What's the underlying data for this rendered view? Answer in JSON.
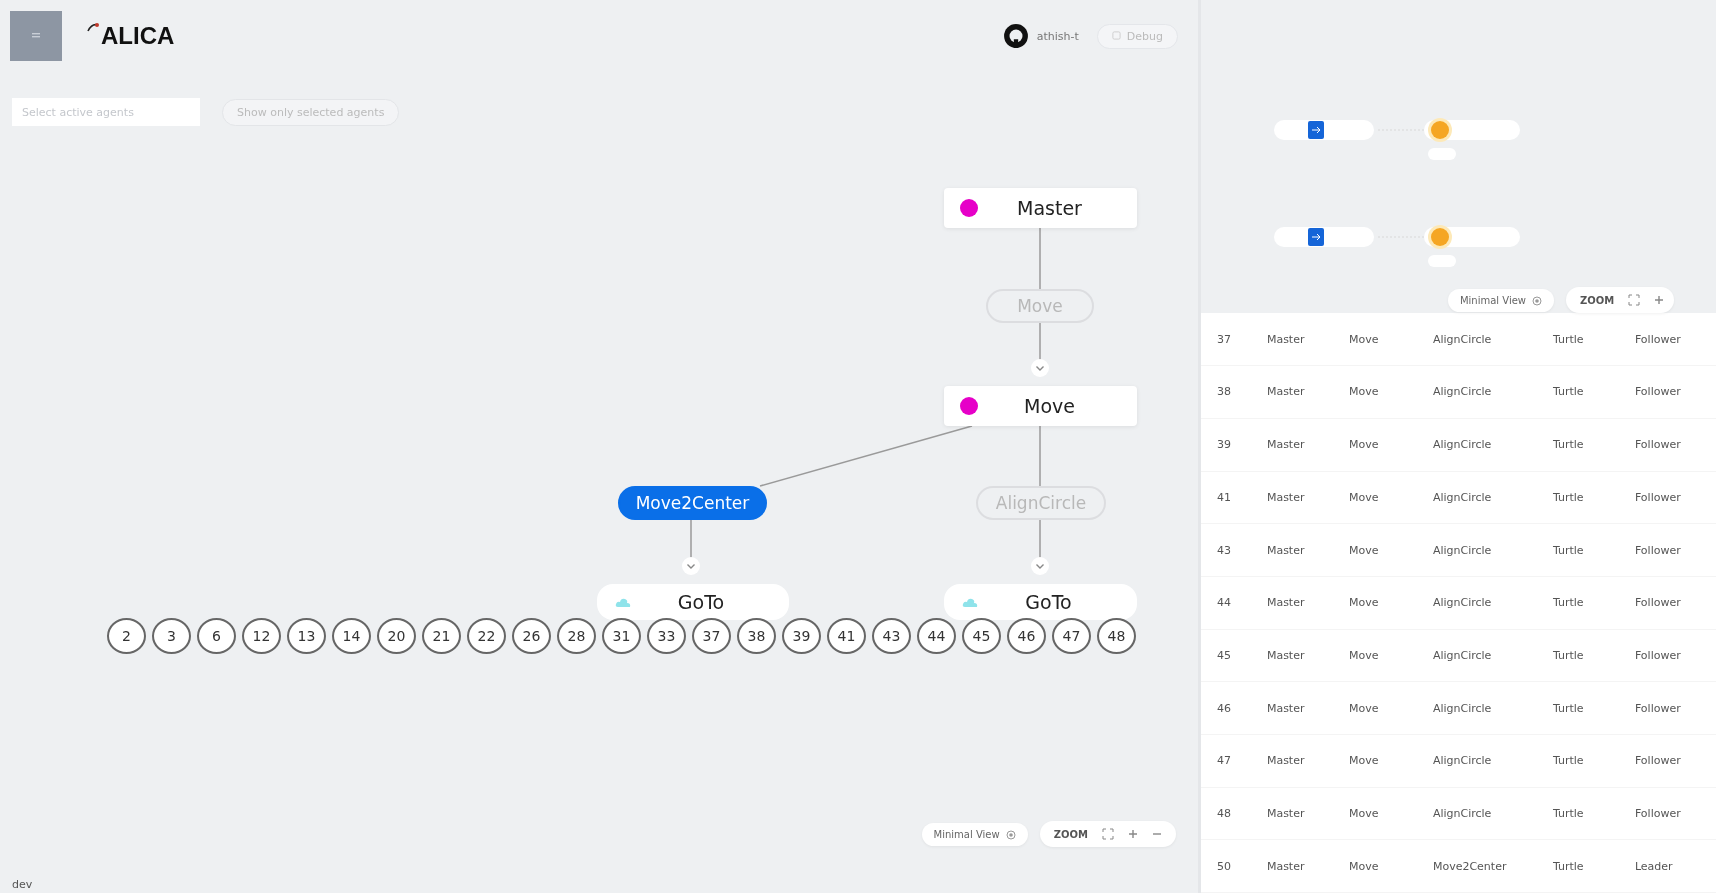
{
  "header": {
    "logo": "ALICA",
    "user": "athish-t",
    "debug_button": "Debug"
  },
  "filters": {
    "agent_select": {
      "placeholder": "Select active agents"
    },
    "show_selected_button": "Show only selected agents"
  },
  "plan_graph": {
    "nodes": [
      {
        "kind": "plan",
        "label": "Master"
      },
      {
        "kind": "state",
        "label": "Move",
        "selected": false
      },
      {
        "kind": "plan",
        "label": "Move"
      },
      {
        "kind": "state",
        "label": "Move2Center",
        "selected": true
      },
      {
        "kind": "state",
        "label": "AlignCircle",
        "selected": false
      },
      {
        "kind": "behaviour",
        "label": "GoTo"
      },
      {
        "kind": "behaviour",
        "label": "GoTo"
      }
    ],
    "agents": [
      "2",
      "3",
      "6",
      "12",
      "13",
      "14",
      "20",
      "21",
      "22",
      "26",
      "28",
      "31",
      "33",
      "37",
      "38",
      "39",
      "41",
      "43",
      "44",
      "45",
      "46",
      "47",
      "48"
    ],
    "view_controls": {
      "minimal_view": "Minimal View",
      "zoom": "ZOOM"
    }
  },
  "environment": "dev",
  "detail_panel": {
    "view_controls": {
      "minimal_view": "Minimal View",
      "zoom": "ZOOM"
    },
    "table": {
      "rows": [
        [
          "37",
          "Master",
          "Move",
          "AlignCircle",
          "Turtle",
          "Follower"
        ],
        [
          "38",
          "Master",
          "Move",
          "AlignCircle",
          "Turtle",
          "Follower"
        ],
        [
          "39",
          "Master",
          "Move",
          "AlignCircle",
          "Turtle",
          "Follower"
        ],
        [
          "41",
          "Master",
          "Move",
          "AlignCircle",
          "Turtle",
          "Follower"
        ],
        [
          "43",
          "Master",
          "Move",
          "AlignCircle",
          "Turtle",
          "Follower"
        ],
        [
          "44",
          "Master",
          "Move",
          "AlignCircle",
          "Turtle",
          "Follower"
        ],
        [
          "45",
          "Master",
          "Move",
          "AlignCircle",
          "Turtle",
          "Follower"
        ],
        [
          "46",
          "Master",
          "Move",
          "AlignCircle",
          "Turtle",
          "Follower"
        ],
        [
          "47",
          "Master",
          "Move",
          "AlignCircle",
          "Turtle",
          "Follower"
        ],
        [
          "48",
          "Master",
          "Move",
          "AlignCircle",
          "Turtle",
          "Follower"
        ],
        [
          "50",
          "Master",
          "Move",
          "Move2Center",
          "Turtle",
          "Leader"
        ]
      ]
    }
  }
}
